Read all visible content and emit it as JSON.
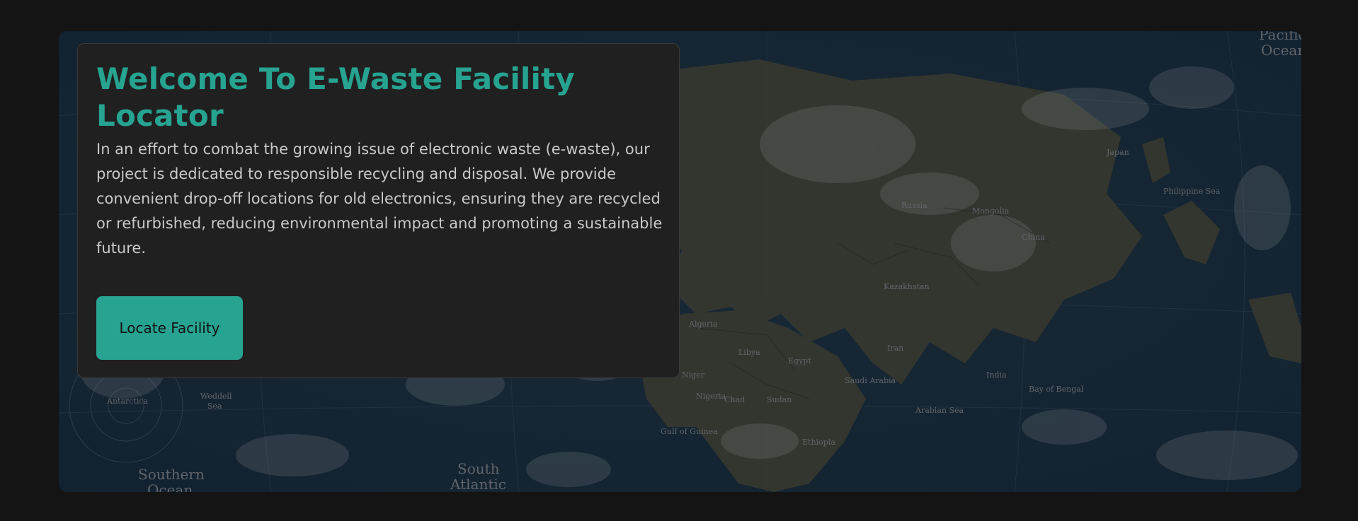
{
  "hero": {
    "title": "Welcome To E-Waste Facility Locator",
    "description": "In an effort to combat the growing issue of electronic waste (e-waste), our project is dedicated to responsible recycling and disposal. We provide convenient drop-off locations for old electronics, ensuring they are recycled or refurbished, reducing environmental impact and promoting a sustainable future.",
    "cta_label": "Locate Facility"
  },
  "map": {
    "labels": {
      "pacific_line1": "Pacific",
      "pacific_line2": "Ocean",
      "southern_line1": "Southern",
      "southern_line2": "Ocean",
      "south_atlantic_line1": "South",
      "south_atlantic_line2": "Atlantic",
      "antarctica": "Antarctica",
      "weddell": "Weddell",
      "weddell_sea": "Sea",
      "mongolia": "Mongolia",
      "china": "China",
      "kazakhstan": "Kazakhstan",
      "india": "India",
      "iran": "Iran",
      "saudi_arabia": "Saudi Arabia",
      "egypt": "Egypt",
      "libya": "Libya",
      "algeria": "Algeria",
      "sudan": "Sudan",
      "chad": "Chad",
      "niger": "Niger",
      "nigeria": "Nigeria",
      "ethiopia": "Ethiopia",
      "japan": "Japan",
      "philippine_sea": "Philippine Sea",
      "bay_of_bengal": "Bay of Bengal",
      "arabian_sea": "Arabian Sea",
      "gulf_of_guinea": "Gulf of Guinea",
      "russia": "Russia"
    }
  },
  "colors": {
    "accent": "#27a391",
    "page_bg": "#141414",
    "card_bg": "#202020",
    "ocean": "#162a3a",
    "land": "#4a4a38"
  }
}
